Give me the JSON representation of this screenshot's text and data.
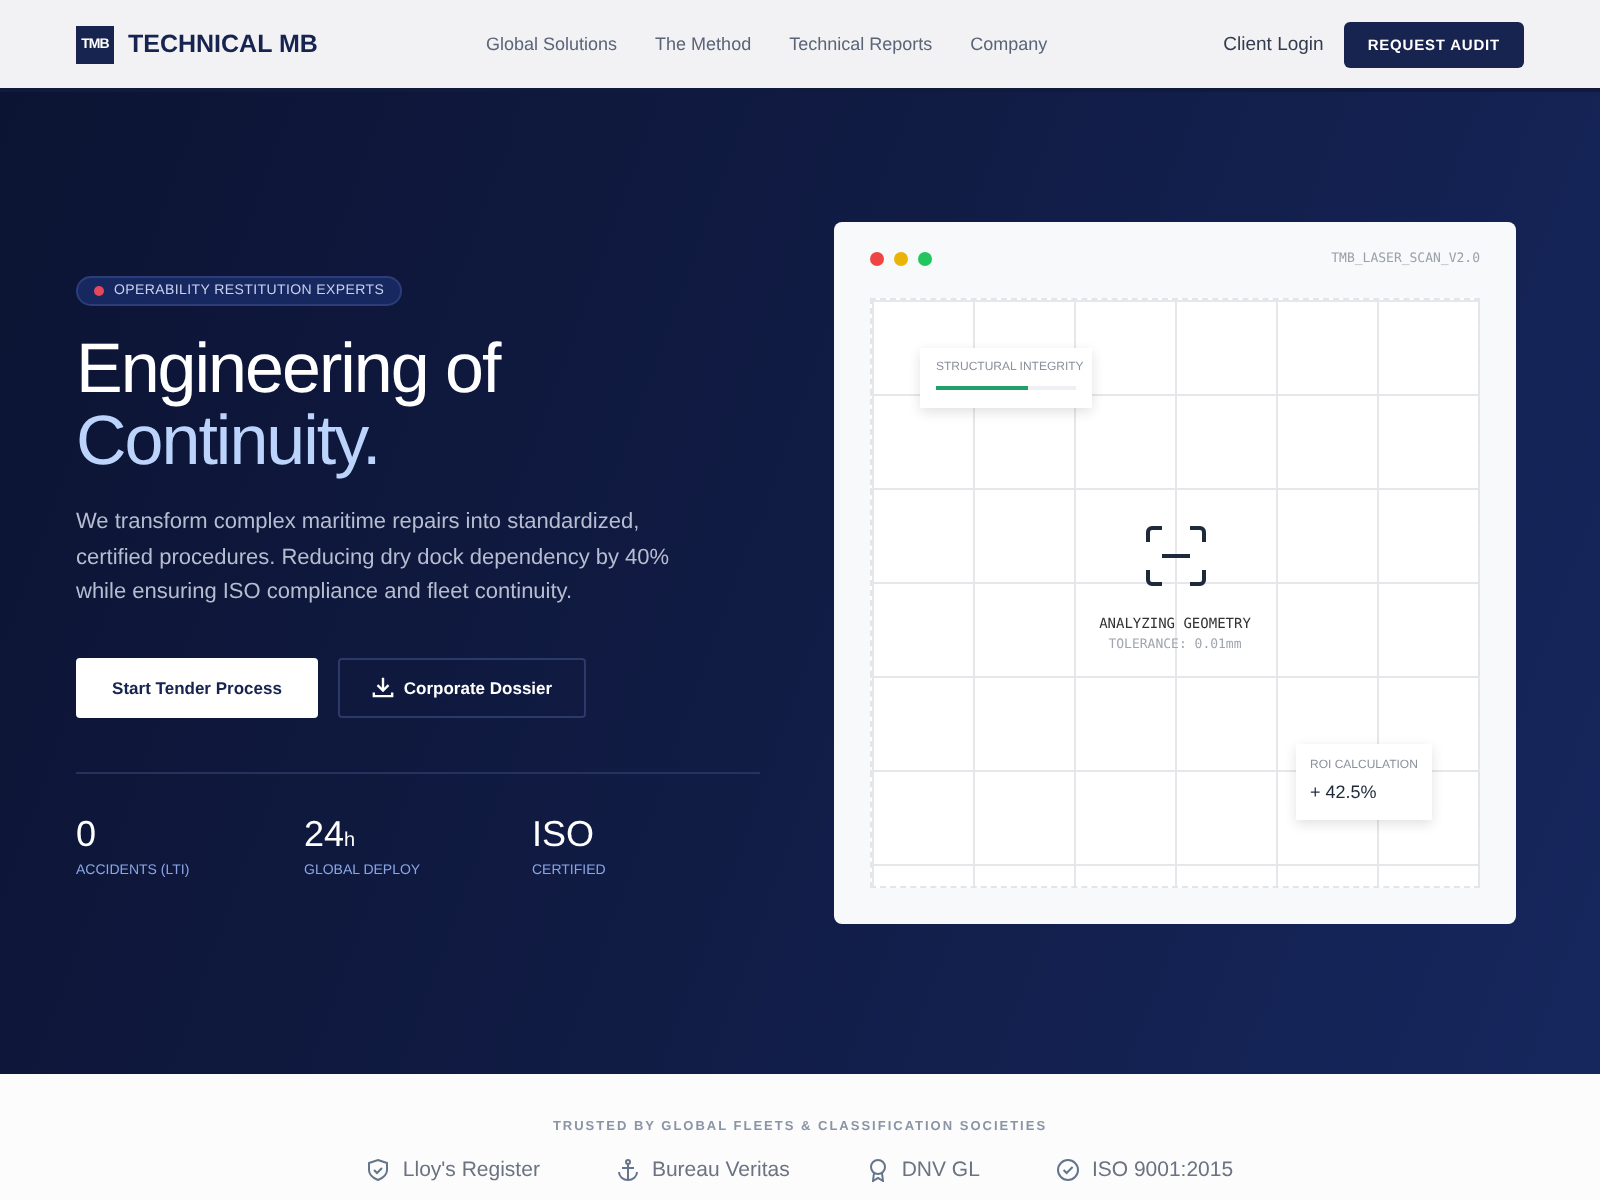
{
  "nav": {
    "logo_mark": "TMB",
    "brand": "TECHNICAL MB",
    "links": [
      "Global Solutions",
      "The Method",
      "Technical Reports",
      "Company"
    ],
    "login": "Client Login",
    "cta": "REQUEST AUDIT"
  },
  "hero": {
    "badge": "OPERABILITY RESTITUTION EXPERTS",
    "title_line1": "Engineering of",
    "title_line2": "Continuity.",
    "description": "We transform complex maritime repairs into standardized, certified procedures. Reducing dry dock dependency by 40% while ensuring ISO compliance and fleet continuity.",
    "buttons": [
      {
        "label": "Start Tender Process",
        "kind": "primary"
      },
      {
        "label": "Corporate Dossier",
        "kind": "download"
      }
    ],
    "stats": [
      {
        "value": "0",
        "label": "ACCIDENTS (LTI)"
      },
      {
        "value": "24",
        "unit": "h",
        "label": "GLOBAL DEPLOY"
      },
      {
        "value": "ISO",
        "label": "CERTIFIED"
      }
    ]
  },
  "scan_window": {
    "dots": [
      {
        "color": "#ef4444"
      },
      {
        "color": "#eab308"
      },
      {
        "color": "#22c55e"
      }
    ],
    "title": "TMB_LASER_SCAN_V2.0",
    "integrity": {
      "label": "STRUCTURAL INTEGRITY",
      "level": 0.65
    },
    "status": "ANALYZING GEOMETRY",
    "tolerance": "TOLERANCE: 0.01mm",
    "roi": {
      "label": "ROI CALCULATION",
      "value": "+ 42.5%"
    }
  },
  "trust": {
    "heading": "TRUSTED BY GLOBAL FLEETS & CLASSIFICATION SOCIETIES",
    "partners": [
      {
        "name": "Lloy's Register",
        "kind": "shield"
      },
      {
        "name": "Bureau Veritas",
        "kind": "anchor"
      },
      {
        "name": "DNV GL",
        "kind": "award"
      },
      {
        "name": "ISO 9001:2015",
        "kind": "check"
      }
    ]
  }
}
